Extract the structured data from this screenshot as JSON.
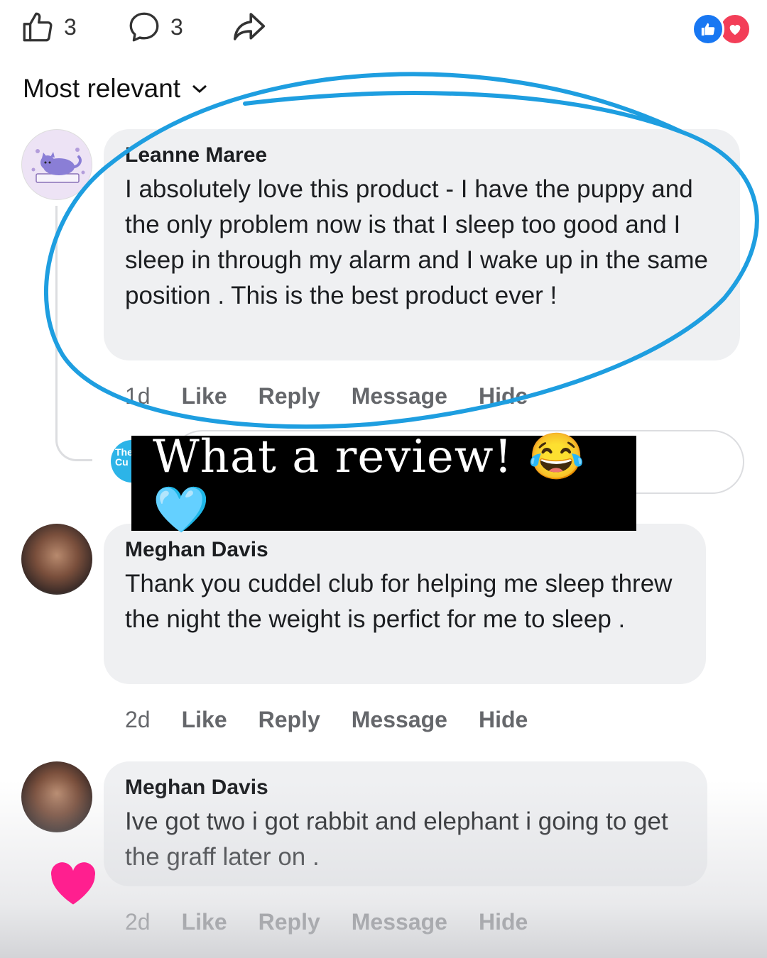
{
  "post_actions": {
    "like_count": "3",
    "comment_count": "3",
    "icons": [
      "thumbs-up-icon",
      "comment-icon",
      "share-icon"
    ],
    "reactions": [
      "like-reaction-icon",
      "love-reaction-icon"
    ]
  },
  "sort": {
    "label": "Most relevant"
  },
  "colors": {
    "accent": "#1877f2",
    "love": "#f33e58",
    "annotation": "#1e9ee0",
    "bubble": "#eff0f2"
  },
  "comments": [
    {
      "name": "Leanne Maree",
      "text": "I absolutely love this product - I have the puppy and the only problem now is that I sleep too good and I sleep in through my alarm and I wake up in the same position . This is the best product ever !",
      "time": "1d",
      "actions": [
        "Like",
        "Reply",
        "Message",
        "Hide"
      ]
    },
    {
      "name": "Meghan Davis",
      "text": "Thank you cuddel club for helping me sleep threw the night  the weight is perfict for me to sleep .",
      "time": "2d",
      "actions": [
        "Like",
        "Reply",
        "Message",
        "Hide"
      ]
    },
    {
      "name": "Meghan Davis",
      "text": "Ive got two i got rabbit and elephant i going to get the graff later on .",
      "time": "2d",
      "actions": [
        "Like",
        "Reply",
        "Message",
        "Hide"
      ]
    }
  ],
  "overlay": {
    "caption": "What a review! 😂🩵"
  }
}
